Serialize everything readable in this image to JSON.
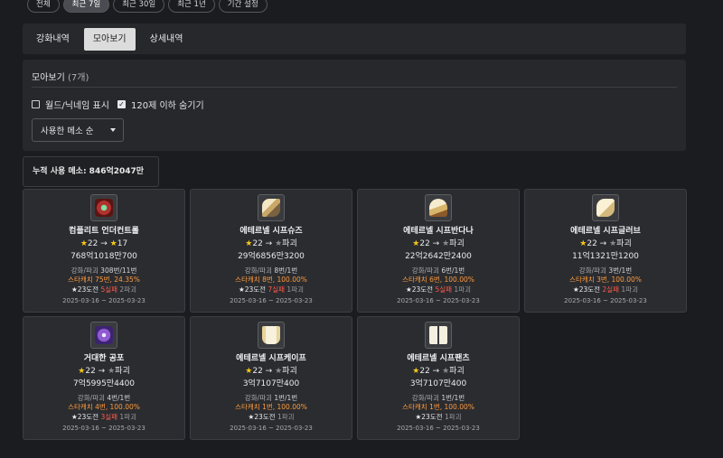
{
  "filters": [
    "전체",
    "최근 7일",
    "최근 30일",
    "최근 1년",
    "기간 설정"
  ],
  "tabs": [
    "강화내역",
    "모아보기",
    "상세내역"
  ],
  "panel": {
    "title": "모아보기",
    "count": "(7개)",
    "option1": "월드/닉네임 표시",
    "option2": "120제 이하 숨기기",
    "sort": "사용한 메소 순"
  },
  "total": "누적 사용 메소: 846억2047만2700",
  "cards": [
    {
      "name": "컴플리트 언더컨트롤",
      "from": "22",
      "to": "17",
      "meso": "768억1018만700",
      "count_label": "강화/파괴",
      "count": "308번/11번",
      "catch": "스타캐치 75번, 24.35%",
      "try": "★23도전",
      "fail": "5실패",
      "destroy": "2파괴",
      "date": "2025-03-16 ~ 2025-03-23",
      "icon": "skull-gem-icon"
    },
    {
      "name": "에테르넬 시프슈즈",
      "from": "22",
      "to": "파괴",
      "meso": "29억6856만3200",
      "count_label": "강화/파괴",
      "count": "8번/1번",
      "catch": "스타캐치 8번, 100.00%",
      "try": "★23도전",
      "fail": "7실패",
      "destroy": "1파괴",
      "date": "2025-03-16 ~ 2025-03-23",
      "icon": "shoes-icon"
    },
    {
      "name": "에테르넬 시프반다나",
      "from": "22",
      "to": "파괴",
      "meso": "22억2642만2400",
      "count_label": "강화/파괴",
      "count": "6번/1번",
      "catch": "스타캐치 6번, 100.00%",
      "try": "★23도전",
      "fail": "5실패",
      "destroy": "1파괴",
      "date": "2025-03-16 ~ 2025-03-23",
      "icon": "bandana-icon"
    },
    {
      "name": "에테르넬 시프글러브",
      "from": "22",
      "to": "파괴",
      "meso": "11억1321만1200",
      "count_label": "강화/파괴",
      "count": "3번/1번",
      "catch": "스타캐치 3번, 100.00%",
      "try": "★23도전",
      "fail": "2실패",
      "destroy": "1파괴",
      "date": "2025-03-16 ~ 2025-03-23",
      "icon": "glove-icon"
    },
    {
      "name": "거대한 공포",
      "from": "22",
      "to": "파괴",
      "meso": "7억5995만4400",
      "count_label": "강화/파괴",
      "count": "4번/1번",
      "catch": "스타캐치 4번, 100.00%",
      "try": "★23도전",
      "fail": "3실패",
      "destroy": "1파괴",
      "date": "2025-03-16 ~ 2025-03-23",
      "icon": "pendant-icon"
    },
    {
      "name": "에테르넬 시프케이프",
      "from": "22",
      "to": "파괴",
      "meso": "3억7107만400",
      "count_label": "강화/파괴",
      "count": "1번/1번",
      "catch": "스타캐치 1번, 100.00%",
      "try": "★23도전",
      "fail": "",
      "destroy": "1파괴",
      "date": "2025-03-16 ~ 2025-03-23",
      "icon": "cape-icon"
    },
    {
      "name": "에테르넬 시프팬츠",
      "from": "22",
      "to": "파괴",
      "meso": "3억7107만400",
      "count_label": "강화/파괴",
      "count": "1번/1번",
      "catch": "스타캐치 1번, 100.00%",
      "try": "★23도전",
      "fail": "",
      "destroy": "1파괴",
      "date": "2025-03-16 ~ 2025-03-23",
      "icon": "pants-icon"
    }
  ],
  "colors": {
    "accent": "#f5c518",
    "fail": "#ff5a4a",
    "catch": "#ff9a3c"
  }
}
